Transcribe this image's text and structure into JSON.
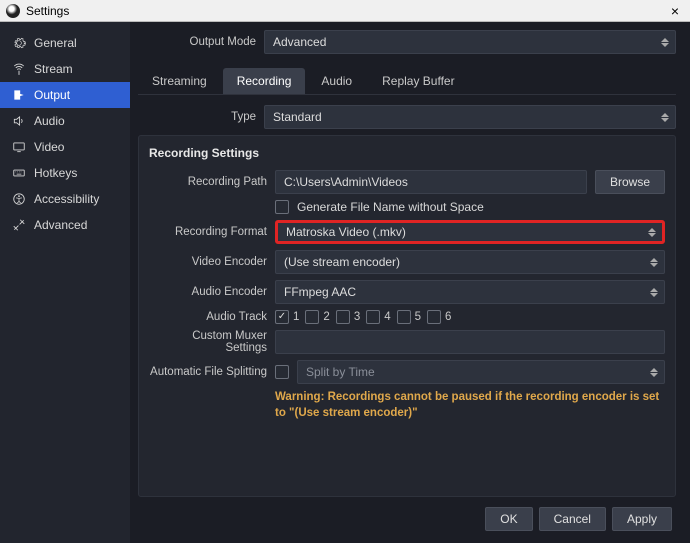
{
  "window": {
    "title": "Settings"
  },
  "sidebar": {
    "items": [
      {
        "label": "General"
      },
      {
        "label": "Stream"
      },
      {
        "label": "Output"
      },
      {
        "label": "Audio"
      },
      {
        "label": "Video"
      },
      {
        "label": "Hotkeys"
      },
      {
        "label": "Accessibility"
      },
      {
        "label": "Advanced"
      }
    ]
  },
  "top": {
    "output_mode_label": "Output Mode",
    "output_mode_value": "Advanced"
  },
  "tabs": {
    "streaming": "Streaming",
    "recording": "Recording",
    "audio": "Audio",
    "replay_buffer": "Replay Buffer"
  },
  "type_row": {
    "label": "Type",
    "value": "Standard"
  },
  "panel": {
    "heading": "Recording Settings",
    "recording_path": {
      "label": "Recording Path",
      "value": "C:\\Users\\Admin\\Videos",
      "browse": "Browse"
    },
    "gen_no_space": {
      "label": "Generate File Name without Space",
      "checked": false
    },
    "recording_format": {
      "label": "Recording Format",
      "value": "Matroska Video (.mkv)"
    },
    "video_encoder": {
      "label": "Video Encoder",
      "value": "(Use stream encoder)"
    },
    "audio_encoder": {
      "label": "Audio Encoder",
      "value": "FFmpeg AAC"
    },
    "audio_track": {
      "label": "Audio Track",
      "tracks": [
        {
          "n": "1",
          "checked": true
        },
        {
          "n": "2",
          "checked": false
        },
        {
          "n": "3",
          "checked": false
        },
        {
          "n": "4",
          "checked": false
        },
        {
          "n": "5",
          "checked": false
        },
        {
          "n": "6",
          "checked": false
        }
      ]
    },
    "custom_muxer": {
      "label": "Custom Muxer Settings",
      "value": ""
    },
    "auto_split": {
      "label": "Automatic File Splitting",
      "checked": false,
      "mode_value": "Split by Time"
    },
    "warning": "Warning: Recordings cannot be paused if the recording encoder is set to \"(Use stream encoder)\""
  },
  "footer": {
    "ok": "OK",
    "cancel": "Cancel",
    "apply": "Apply"
  }
}
